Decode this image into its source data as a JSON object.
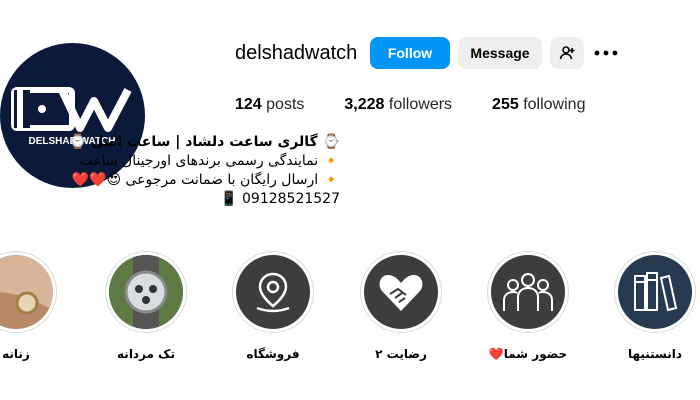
{
  "profile": {
    "username": "delshadwatch",
    "avatar_text": "DW",
    "avatar_subtext": "DELSHAD WATCH",
    "follow_label": "Follow",
    "message_label": "Message"
  },
  "stats": {
    "posts_count": "124",
    "posts_label": "posts",
    "followers_count": "3,228",
    "followers_label": "followers",
    "following_count": "255",
    "following_label": "following"
  },
  "bio": {
    "title": "⌚ گالری ساعت دلشاد | ساعت اصل ⌚",
    "line1": "🔸 نمایندگی رسمی برندهای اورجینال ساعت",
    "line2": "🔸 ارسال رایگان با ضمانت مرجوعی 😍❤️❤️",
    "phone": "📱 09128521527"
  },
  "highlights": [
    {
      "label": "زنانه",
      "icon": "woman-watch-photo"
    },
    {
      "label": "تک مردانه",
      "icon": "men-watch-photo"
    },
    {
      "label": "فروشگاه",
      "icon": "location-pin-icon"
    },
    {
      "label": "رضایت ۲",
      "icon": "handshake-heart-icon"
    },
    {
      "label": "حضور شما❤️",
      "icon": "people-group-icon"
    },
    {
      "label": "دانستنیها",
      "icon": "books-icon"
    }
  ],
  "colors": {
    "follow_button": "#0095f6",
    "secondary_button": "#efefef",
    "avatar_bg": "#0b1a3a",
    "highlight_bg": "#3d3d3d"
  }
}
